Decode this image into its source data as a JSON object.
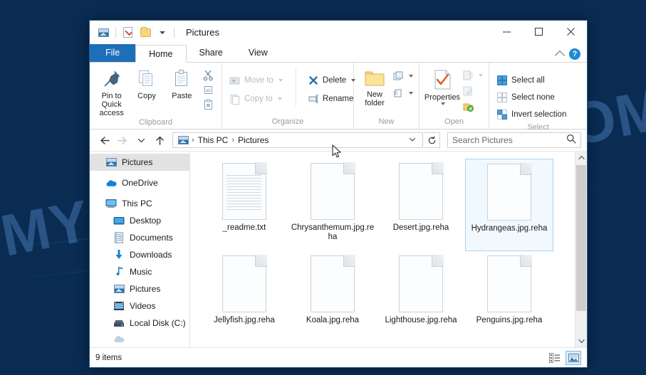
{
  "watermark": {
    "text": "MYANTISPYWARE.COM"
  },
  "window": {
    "title": "Pictures",
    "quick_access": {
      "picture_tools_icon": "picture-icon",
      "properties_icon": "properties-icon",
      "new_folder_icon": "folder-icon",
      "customize_icon": "chevron-down-icon"
    },
    "controls": {
      "minimize": "minimize-icon",
      "maximize": "maximize-icon",
      "close": "close-icon"
    }
  },
  "tabs": [
    {
      "label": "File",
      "active": false,
      "style": "file"
    },
    {
      "label": "Home",
      "active": true,
      "style": "normal"
    },
    {
      "label": "Share",
      "active": false,
      "style": "normal"
    },
    {
      "label": "View",
      "active": false,
      "style": "normal"
    }
  ],
  "tab_right": {
    "collapse_ribbon_icon": "chevron-up-icon",
    "help_label": "?"
  },
  "ribbon": {
    "groups": [
      {
        "name": "Clipboard",
        "label": "Clipboard",
        "big_buttons": [
          {
            "label": "Pin to Quick access",
            "icon": "pin-icon",
            "enabled": true
          },
          {
            "label": "Copy",
            "icon": "copy-icon",
            "enabled": true
          },
          {
            "label": "Paste",
            "icon": "paste-icon",
            "enabled": true
          }
        ],
        "small_buttons": [
          {
            "label": "",
            "icon": "cut-icon",
            "enabled": true
          },
          {
            "label": "",
            "icon": "copy-path-icon",
            "enabled": true
          },
          {
            "label": "",
            "icon": "paste-shortcut-icon",
            "enabled": true
          }
        ]
      },
      {
        "name": "Organize",
        "label": "Organize",
        "small_buttons": [
          {
            "label": "Move to",
            "icon": "move-to-icon",
            "enabled": false,
            "has_menu": true
          },
          {
            "label": "Copy to",
            "icon": "copy-to-icon",
            "enabled": false,
            "has_menu": true
          },
          {
            "label": "Delete",
            "icon": "delete-icon",
            "enabled": true,
            "has_menu": true
          },
          {
            "label": "Rename",
            "icon": "rename-icon",
            "enabled": true,
            "has_menu": false
          }
        ]
      },
      {
        "name": "New",
        "label": "New",
        "big_buttons": [
          {
            "label": "New folder",
            "icon": "new-folder-icon",
            "enabled": true
          }
        ],
        "small_buttons": [
          {
            "label": "",
            "icon": "new-item-icon",
            "enabled": true,
            "has_menu": true
          },
          {
            "label": "",
            "icon": "easy-access-icon",
            "enabled": true,
            "has_menu": true
          }
        ]
      },
      {
        "name": "Open",
        "label": "Open",
        "big_buttons": [
          {
            "label": "Properties",
            "icon": "properties-icon",
            "enabled": true,
            "has_menu": true
          }
        ],
        "small_buttons": [
          {
            "label": "",
            "icon": "open-icon",
            "enabled": false,
            "has_menu": true
          },
          {
            "label": "",
            "icon": "edit-icon",
            "enabled": false
          },
          {
            "label": "",
            "icon": "history-icon",
            "enabled": true
          }
        ]
      },
      {
        "name": "Select",
        "label": "Select",
        "small_buttons": [
          {
            "label": "Select all",
            "icon": "select-all-icon",
            "enabled": true
          },
          {
            "label": "Select none",
            "icon": "select-none-icon",
            "enabled": true
          },
          {
            "label": "Invert selection",
            "icon": "invert-selection-icon",
            "enabled": true
          }
        ]
      }
    ]
  },
  "address_bar": {
    "back_icon": "back-arrow-icon",
    "forward_icon": "forward-arrow-icon",
    "recent_icon": "chevron-down-icon",
    "up_icon": "up-arrow-icon",
    "location_icon": "picture-icon",
    "breadcrumb": [
      "This PC",
      "Pictures"
    ],
    "breadcrumb_chevron": "chevron-down-icon",
    "refresh_icon": "refresh-icon",
    "search": {
      "placeholder": "Search Pictures",
      "value": "",
      "icon": "search-icon"
    }
  },
  "nav_pane": {
    "items": [
      {
        "label": "Pictures",
        "icon": "picture-icon",
        "indent": 0,
        "selected": true
      },
      {
        "label": "OneDrive",
        "icon": "cloud-icon",
        "indent": 0,
        "selected": false
      },
      {
        "label": "This PC",
        "icon": "monitor-icon",
        "indent": 0,
        "selected": false
      },
      {
        "label": "Desktop",
        "icon": "desktop-icon",
        "indent": 1,
        "selected": false
      },
      {
        "label": "Documents",
        "icon": "documents-icon",
        "indent": 1,
        "selected": false
      },
      {
        "label": "Downloads",
        "icon": "download-icon",
        "indent": 1,
        "selected": false
      },
      {
        "label": "Music",
        "icon": "music-note-icon",
        "indent": 1,
        "selected": false
      },
      {
        "label": "Pictures",
        "icon": "picture-icon",
        "indent": 1,
        "selected": false
      },
      {
        "label": "Videos",
        "icon": "video-icon",
        "indent": 1,
        "selected": false
      },
      {
        "label": "Local Disk (C:)",
        "icon": "drive-icon",
        "indent": 1,
        "selected": false
      }
    ]
  },
  "files": [
    {
      "name": "_readme.txt",
      "icon": "text-file-icon",
      "selected": false
    },
    {
      "name": "Chrysanthemum.jpg.reha",
      "icon": "blank-file-icon",
      "selected": false
    },
    {
      "name": "Desert.jpg.reha",
      "icon": "blank-file-icon",
      "selected": false
    },
    {
      "name": "Hydrangeas.jpg.reha",
      "icon": "blank-file-icon",
      "selected": true
    },
    {
      "name": "Jellyfish.jpg.reha",
      "icon": "blank-file-icon",
      "selected": false
    },
    {
      "name": "Koala.jpg.reha",
      "icon": "blank-file-icon",
      "selected": false
    },
    {
      "name": "Lighthouse.jpg.reha",
      "icon": "blank-file-icon",
      "selected": false
    },
    {
      "name": "Penguins.jpg.reha",
      "icon": "blank-file-icon",
      "selected": false
    }
  ],
  "status_bar": {
    "item_count": "9 items",
    "views": [
      {
        "name": "details-view",
        "active": false
      },
      {
        "name": "large-icons-view",
        "active": true
      }
    ]
  },
  "colors": {
    "accent": "#1e6fba",
    "selection_border": "#a9d3f0",
    "selection_fill": "#f2f9fe",
    "desktop": "#0a2c52",
    "watermark": "#568ccd"
  }
}
